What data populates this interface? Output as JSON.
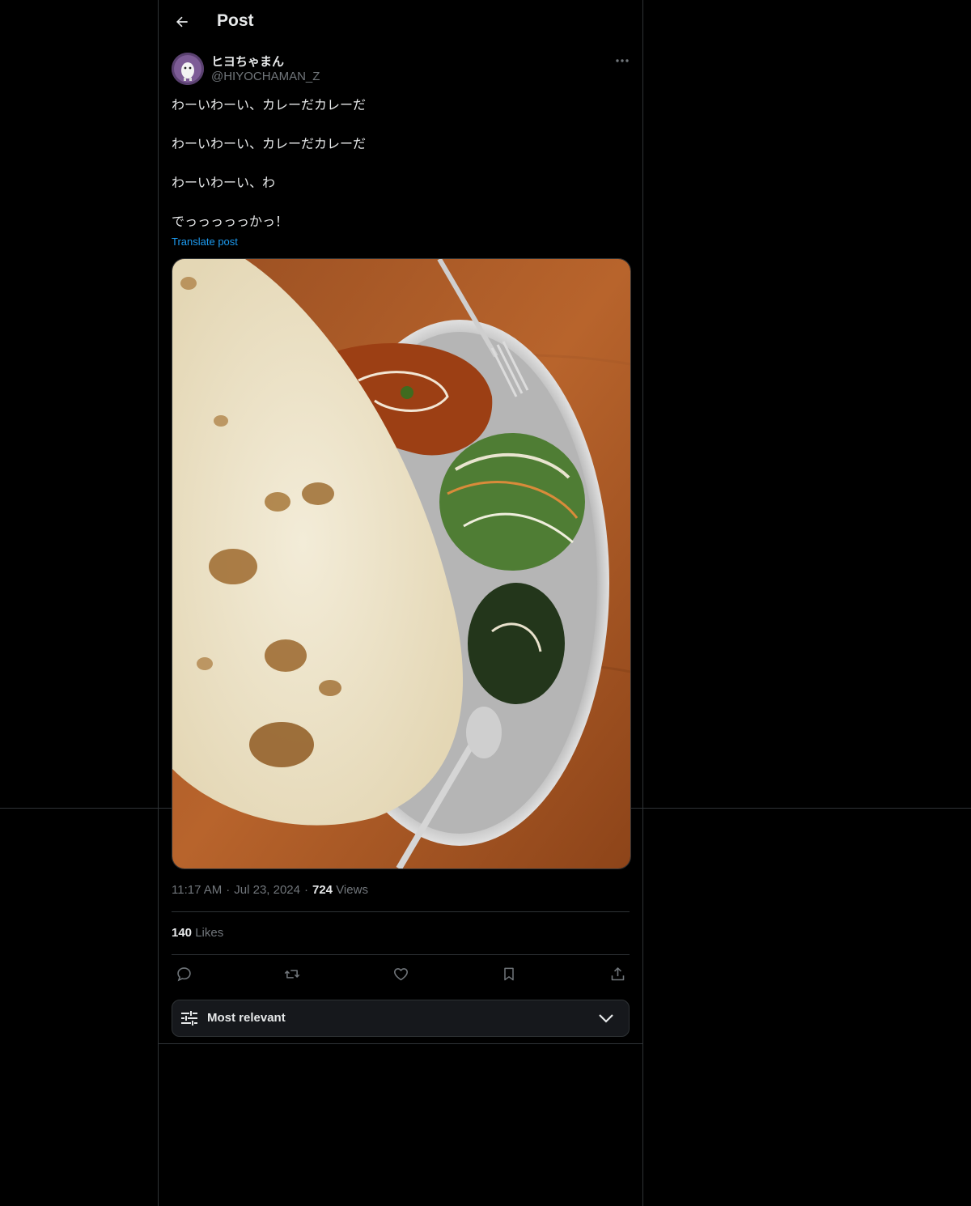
{
  "header": {
    "title": "Post",
    "back_icon": "arrow-left-icon"
  },
  "author": {
    "display_name": "ヒヨちゃまん",
    "handle": "@HIYOCHAMAN_Z",
    "more_icon": "more-horizontal-icon"
  },
  "post": {
    "lines": [
      "わーいわーい、カレーだカレーだ",
      "わーいわーい、カレーだカレーだ",
      "わーいわーい、わ",
      "でっっっっっかっ！"
    ],
    "translate_label": "Translate post"
  },
  "meta": {
    "time": "11:17 AM",
    "date": "Jul 23, 2024",
    "views_count": "724",
    "views_label": "Views",
    "separator": "·"
  },
  "stats": {
    "likes_count": "140",
    "likes_label": "Likes"
  },
  "actions": [
    "reply-icon",
    "repost-icon",
    "like-icon",
    "bookmark-icon",
    "share-icon"
  ],
  "sort": {
    "label": "Most relevant",
    "icon": "sliders-icon",
    "chevron": "chevron-down-icon"
  },
  "colors": {
    "background": "#000000",
    "text": "#e7e9ea",
    "muted": "#71767b",
    "link": "#1d9bf0",
    "border": "#2f3336"
  }
}
